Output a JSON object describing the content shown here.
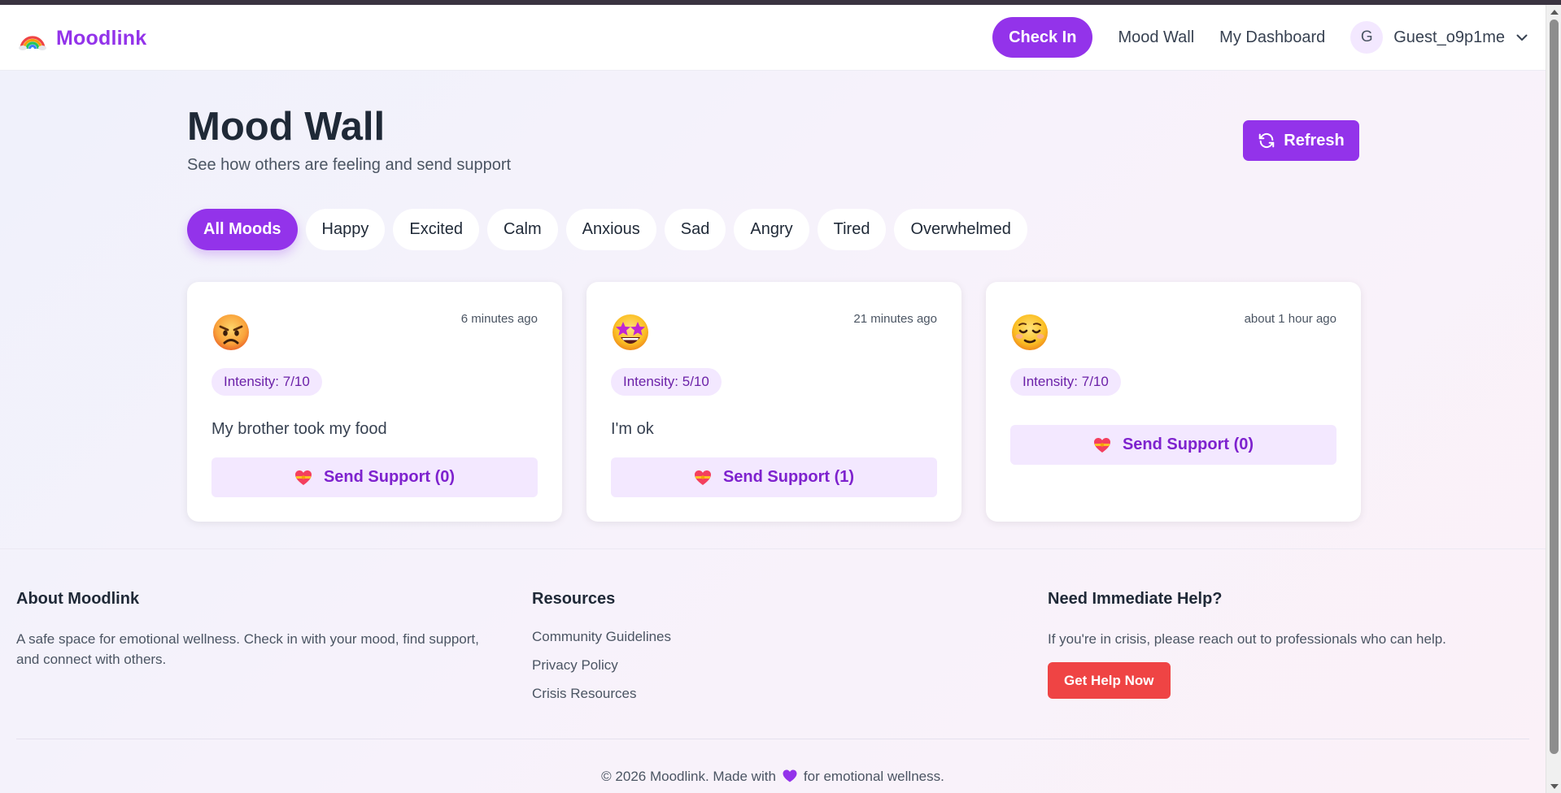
{
  "brand": {
    "name": "Moodlink",
    "logo_icon": "rainbow-icon",
    "accent": "#9333ea"
  },
  "nav": {
    "check_in": "Check In",
    "mood_wall": "Mood Wall",
    "dashboard": "My Dashboard",
    "avatar_initial": "G",
    "user_name": "Guest_o9p1me"
  },
  "page": {
    "title": "Mood Wall",
    "subtitle": "See how others are feeling and send support",
    "refresh": "Refresh"
  },
  "filters": [
    {
      "label": "All Moods",
      "active": true
    },
    {
      "label": "Happy",
      "active": false
    },
    {
      "label": "Excited",
      "active": false
    },
    {
      "label": "Calm",
      "active": false
    },
    {
      "label": "Anxious",
      "active": false
    },
    {
      "label": "Sad",
      "active": false
    },
    {
      "label": "Angry",
      "active": false
    },
    {
      "label": "Tired",
      "active": false
    },
    {
      "label": "Overwhelmed",
      "active": false
    }
  ],
  "cards": [
    {
      "emoji": "angry-face-icon",
      "time": "6 minutes ago",
      "intensity": "Intensity: 7/10",
      "message": "My brother took my food",
      "support": "Send Support (0)"
    },
    {
      "emoji": "star-struck-face-icon",
      "time": "21 minutes ago",
      "intensity": "Intensity: 5/10",
      "message": "I'm ok",
      "support": "Send Support (1)"
    },
    {
      "emoji": "relieved-face-icon",
      "time": "about 1 hour ago",
      "intensity": "Intensity: 7/10",
      "message": "",
      "support": "Send Support (0)"
    }
  ],
  "footer": {
    "about_title": "About Moodlink",
    "about_text": "A safe space for emotional wellness. Check in with your mood, find support, and connect with others.",
    "resources_title": "Resources",
    "resources": [
      "Community Guidelines",
      "Privacy Policy",
      "Crisis Resources"
    ],
    "help_title": "Need Immediate Help?",
    "help_text": "If you're in crisis, please reach out to professionals who can help.",
    "help_button": "Get Help Now",
    "copyright_pre": "© 2026 Moodlink. Made with",
    "copyright_post": "for emotional wellness."
  },
  "colors": {
    "danger": "#ef4444",
    "chip_bg": "#f3e8ff",
    "support_text": "#7e22ce"
  }
}
